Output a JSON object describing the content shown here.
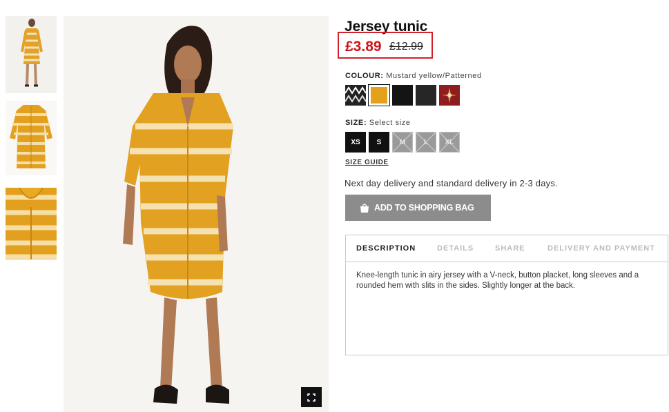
{
  "product": {
    "title": "Jersey tunic",
    "price_new": "£3.89",
    "price_old": "£12.99"
  },
  "colour": {
    "label": "COLOUR:",
    "value": "Mustard yellow/Patterned",
    "swatches": [
      "black-white-ikat",
      "mustard-yellow",
      "black",
      "dark-grey",
      "red-floral"
    ],
    "selected": "mustard-yellow"
  },
  "size": {
    "label": "SIZE:",
    "value": "Select size",
    "options": [
      "XS",
      "S",
      "M",
      "L",
      "XL"
    ],
    "available": [
      "XS",
      "S"
    ],
    "guide_label": "SIZE GUIDE"
  },
  "delivery_text": "Next day delivery and standard delivery in 2-3 days.",
  "add_to_bag_label": "ADD TO SHOPPING BAG",
  "tabs": [
    "DESCRIPTION",
    "DETAILS",
    "SHARE",
    "DELIVERY AND PAYMENT"
  ],
  "active_tab": "DESCRIPTION",
  "description": "Knee-length tunic in airy jersey with a V-neck, button placket, long sleeves and a rounded hem with slits in the sides. Slightly longer at the back.",
  "colors": {
    "sale_red": "#d0141d",
    "mustard": "#e4a11a",
    "button_grey": "#8c8c8c"
  }
}
